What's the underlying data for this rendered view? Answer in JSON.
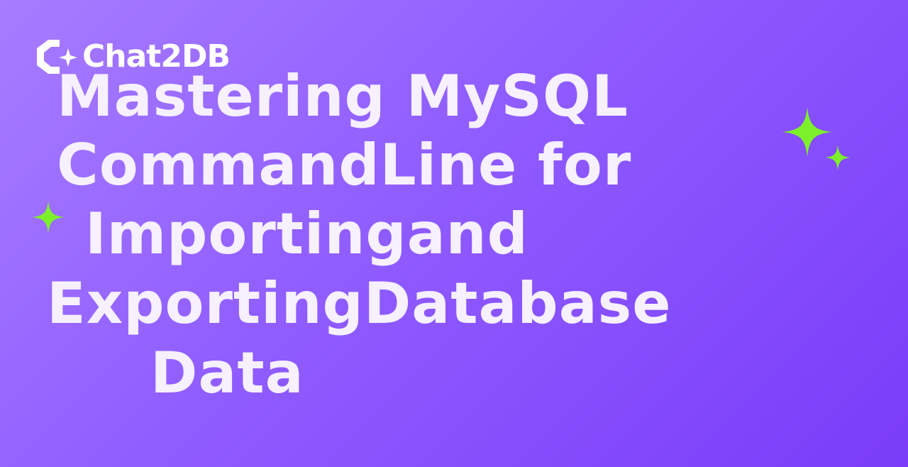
{
  "brand": {
    "name": "Chat2DB",
    "logo_icon": "chat2db-logo-icon"
  },
  "headline": {
    "lines": [
      "Mastering MySQL",
      "CommandLine for",
      "Importingand",
      "ExportingDatabase",
      "Data"
    ]
  },
  "colors": {
    "background_start": "#a77cff",
    "background_end": "#7a3cf8",
    "headline_text": "#f6f0ff",
    "sparkle": "#7cf02a",
    "logo": "#ffffff"
  },
  "decorations": {
    "sparkle_icon": "sparkle-icon"
  }
}
